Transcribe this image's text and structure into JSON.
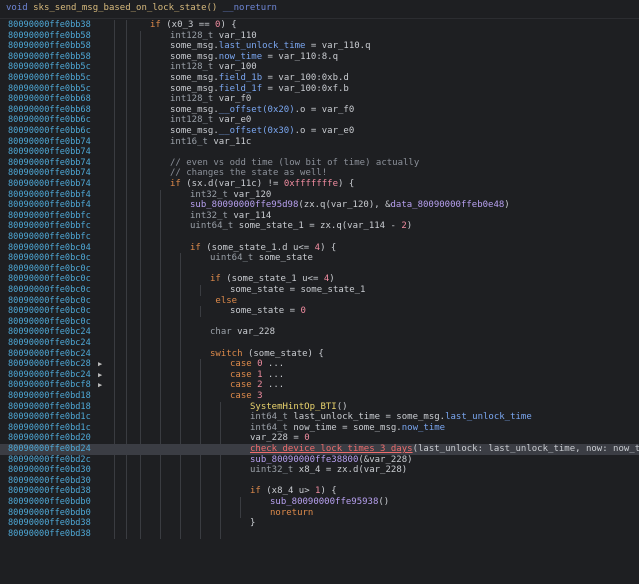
{
  "header": {
    "void_kw": "void",
    "func_name": "sks_send_msg_based_on_lock_state()",
    "noreturn_kw": "__noreturn"
  },
  "rows": [
    {
      "addr": "80090000ffe0bb38",
      "indent": 0,
      "segs": [
        [
          "kw",
          "if "
        ],
        [
          "txt",
          "(x0_3 == "
        ],
        [
          "num",
          "0"
        ],
        [
          "txt",
          ") {"
        ]
      ]
    },
    {
      "addr": "80090000ffe0bb58",
      "indent": 1,
      "segs": [
        [
          "type",
          "int128_t "
        ],
        [
          "txt",
          "var_110"
        ]
      ]
    },
    {
      "addr": "80090000ffe0bb58",
      "indent": 1,
      "segs": [
        [
          "txt",
          "some_msg."
        ],
        [
          "fld",
          "last_unlock_time"
        ],
        [
          "txt",
          " = var_110.q"
        ]
      ]
    },
    {
      "addr": "80090000ffe0bb58",
      "indent": 1,
      "segs": [
        [
          "txt",
          "some_msg."
        ],
        [
          "fld",
          "now_time"
        ],
        [
          "txt",
          " = var_110:8.q"
        ]
      ]
    },
    {
      "addr": "80090000ffe0bb5c",
      "indent": 1,
      "segs": [
        [
          "type",
          "int128_t "
        ],
        [
          "txt",
          "var_100"
        ]
      ]
    },
    {
      "addr": "80090000ffe0bb5c",
      "indent": 1,
      "segs": [
        [
          "txt",
          "some_msg."
        ],
        [
          "fld",
          "field_1b"
        ],
        [
          "txt",
          " = var_100:0xb.d"
        ]
      ]
    },
    {
      "addr": "80090000ffe0bb5c",
      "indent": 1,
      "segs": [
        [
          "txt",
          "some_msg."
        ],
        [
          "fld",
          "field_1f"
        ],
        [
          "txt",
          " = var_100:0xf.b"
        ]
      ]
    },
    {
      "addr": "80090000ffe0bb68",
      "indent": 1,
      "segs": [
        [
          "type",
          "int128_t "
        ],
        [
          "txt",
          "var_f0"
        ]
      ]
    },
    {
      "addr": "80090000ffe0bb68",
      "indent": 1,
      "segs": [
        [
          "txt",
          "some_msg."
        ],
        [
          "fld",
          "__offset(0x20)"
        ],
        [
          "txt",
          ".o = var_f0"
        ]
      ]
    },
    {
      "addr": "80090000ffe0bb6c",
      "indent": 1,
      "segs": [
        [
          "type",
          "int128_t "
        ],
        [
          "txt",
          "var_e0"
        ]
      ]
    },
    {
      "addr": "80090000ffe0bb6c",
      "indent": 1,
      "segs": [
        [
          "txt",
          "some_msg."
        ],
        [
          "fld",
          "__offset(0x30)"
        ],
        [
          "txt",
          ".o = var_e0"
        ]
      ]
    },
    {
      "addr": "80090000ffe0bb74",
      "indent": 1,
      "segs": [
        [
          "type",
          "int16_t "
        ],
        [
          "txt",
          "var_11c"
        ]
      ]
    },
    {
      "addr": "80090000ffe0bb74",
      "indent": 1,
      "segs": []
    },
    {
      "addr": "80090000ffe0bb74",
      "indent": 1,
      "segs": [
        [
          "cmt",
          "// even vs odd time (low bit of time) actually"
        ]
      ]
    },
    {
      "addr": "80090000ffe0bb74",
      "indent": 1,
      "segs": [
        [
          "cmt",
          "// changes the state as well!"
        ]
      ]
    },
    {
      "addr": "80090000ffe0bb74",
      "indent": 1,
      "segs": [
        [
          "kw",
          "if "
        ],
        [
          "txt",
          "(sx.d(var_11c) != "
        ],
        [
          "num",
          "0xfffffffe"
        ],
        [
          "txt",
          ") {"
        ]
      ]
    },
    {
      "addr": "80090000ffe0bbf4",
      "indent": 2,
      "segs": [
        [
          "type",
          "int32_t "
        ],
        [
          "txt",
          "var_120"
        ]
      ]
    },
    {
      "addr": "80090000ffe0bbf4",
      "indent": 2,
      "segs": [
        [
          "sym",
          "sub_80090000ffe95d98"
        ],
        [
          "txt",
          "(zx.q(var_120), &"
        ],
        [
          "sym",
          "data_80090000ffeb0e48"
        ],
        [
          "txt",
          ")"
        ]
      ]
    },
    {
      "addr": "80090000ffe0bbfc",
      "indent": 2,
      "segs": [
        [
          "type",
          "int32_t "
        ],
        [
          "txt",
          "var_114"
        ]
      ]
    },
    {
      "addr": "80090000ffe0bbfc",
      "indent": 2,
      "segs": [
        [
          "type",
          "uint64_t "
        ],
        [
          "txt",
          "some_state_1 = zx.q(var_114 - "
        ],
        [
          "num",
          "2"
        ],
        [
          "txt",
          ")"
        ]
      ]
    },
    {
      "addr": "80090000ffe0bbfc",
      "indent": 2,
      "segs": []
    },
    {
      "addr": "80090000ffe0bc04",
      "indent": 2,
      "segs": [
        [
          "kw",
          "if "
        ],
        [
          "txt",
          "(some_state_1.d u<= "
        ],
        [
          "num",
          "4"
        ],
        [
          "txt",
          ") {"
        ]
      ]
    },
    {
      "addr": "80090000ffe0bc0c",
      "indent": 3,
      "segs": [
        [
          "type",
          "uint64_t "
        ],
        [
          "txt",
          "some_state"
        ]
      ]
    },
    {
      "addr": "80090000ffe0bc0c",
      "indent": 3,
      "segs": []
    },
    {
      "addr": "80090000ffe0bc0c",
      "indent": 3,
      "segs": [
        [
          "kw",
          "if "
        ],
        [
          "txt",
          "(some_state_1 u<= "
        ],
        [
          "num",
          "4"
        ],
        [
          "txt",
          ")"
        ]
      ]
    },
    {
      "addr": "80090000ffe0bc0c",
      "indent": 4,
      "segs": [
        [
          "txt",
          "some_state = some_state_1"
        ]
      ]
    },
    {
      "addr": "80090000ffe0bc0c",
      "indent": 3,
      "segs": [
        [
          "kw",
          " else"
        ]
      ]
    },
    {
      "addr": "80090000ffe0bc0c",
      "indent": 4,
      "segs": [
        [
          "txt",
          "some_state = "
        ],
        [
          "num",
          "0"
        ]
      ]
    },
    {
      "addr": "80090000ffe0bc0c",
      "indent": 3,
      "segs": []
    },
    {
      "addr": "80090000ffe0bc24",
      "indent": 3,
      "segs": [
        [
          "type",
          "char "
        ],
        [
          "txt",
          "var_228"
        ]
      ]
    },
    {
      "addr": "80090000ffe0bc24",
      "indent": 3,
      "segs": []
    },
    {
      "addr": "80090000ffe0bc24",
      "indent": 3,
      "segs": [
        [
          "kw",
          "switch "
        ],
        [
          "txt",
          "(some_state) {"
        ]
      ]
    },
    {
      "addr": "80090000ffe0bc28",
      "indent": 4,
      "arrow": "▶",
      "segs": [
        [
          "kw",
          "case "
        ],
        [
          "num",
          "0"
        ],
        [
          "txt",
          " ..."
        ]
      ]
    },
    {
      "addr": "80090000ffe0bc24",
      "indent": 4,
      "arrow": "▶",
      "segs": [
        [
          "kw",
          "case "
        ],
        [
          "num",
          "1"
        ],
        [
          "txt",
          " ..."
        ]
      ]
    },
    {
      "addr": "80090000ffe0bcf8",
      "indent": 4,
      "arrow": "▶",
      "segs": [
        [
          "kw",
          "case "
        ],
        [
          "num",
          "2"
        ],
        [
          "txt",
          " ..."
        ]
      ]
    },
    {
      "addr": "80090000ffe0bd18",
      "indent": 4,
      "segs": [
        [
          "kw",
          "case "
        ],
        [
          "num",
          "3"
        ]
      ]
    },
    {
      "addr": "80090000ffe0bd18",
      "indent": 5,
      "segs": [
        [
          "call",
          "SystemHintOp_BTI"
        ],
        [
          "txt",
          "()"
        ]
      ]
    },
    {
      "addr": "80090000ffe0bd1c",
      "indent": 5,
      "segs": [
        [
          "type",
          "int64_t "
        ],
        [
          "txt",
          "last_unlock_time = some_msg."
        ],
        [
          "fld",
          "last_unlock_time"
        ]
      ]
    },
    {
      "addr": "80090000ffe0bd1c",
      "indent": 5,
      "segs": [
        [
          "type",
          "int64_t "
        ],
        [
          "txt",
          "now_time = some_msg."
        ],
        [
          "fld",
          "now_time"
        ]
      ]
    },
    {
      "addr": "80090000ffe0bd20",
      "indent": 5,
      "segs": [
        [
          "txt",
          "var_228 = "
        ],
        [
          "num",
          "0"
        ]
      ]
    },
    {
      "addr": "80090000ffe0bd24",
      "indent": 5,
      "hl": true,
      "segs": [
        [
          "err",
          "check_device_lock_times_3_days"
        ],
        [
          "txt",
          "(last_unlock: last_unlock_time, now: now_time)"
        ]
      ]
    },
    {
      "addr": "80090000ffe0bd2c",
      "indent": 5,
      "segs": [
        [
          "sym",
          "sub_80090000ffe38800"
        ],
        [
          "txt",
          "(&var_228)"
        ]
      ]
    },
    {
      "addr": "80090000ffe0bd30",
      "indent": 5,
      "segs": [
        [
          "type",
          "uint32_t "
        ],
        [
          "txt",
          "x8_4 = zx.d(var_228)"
        ]
      ]
    },
    {
      "addr": "80090000ffe0bd30",
      "indent": 5,
      "segs": []
    },
    {
      "addr": "80090000ffe0bd38",
      "indent": 5,
      "segs": [
        [
          "kw",
          "if "
        ],
        [
          "txt",
          "(x8_4 u> "
        ],
        [
          "num",
          "1"
        ],
        [
          "txt",
          ") {"
        ]
      ]
    },
    {
      "addr": "80090000ffe0bdb0",
      "indent": 6,
      "segs": [
        [
          "sym",
          "sub_80090000ffe95938"
        ],
        [
          "txt",
          "()"
        ]
      ]
    },
    {
      "addr": "80090000ffe0bdb0",
      "indent": 6,
      "segs": [
        [
          "kw",
          "noreturn"
        ]
      ]
    },
    {
      "addr": "80090000ffe0bd38",
      "indent": 5,
      "segs": [
        [
          "txt",
          "}"
        ]
      ]
    },
    {
      "addr": "80090000ffe0bd38",
      "indent": 5,
      "segs": []
    }
  ]
}
